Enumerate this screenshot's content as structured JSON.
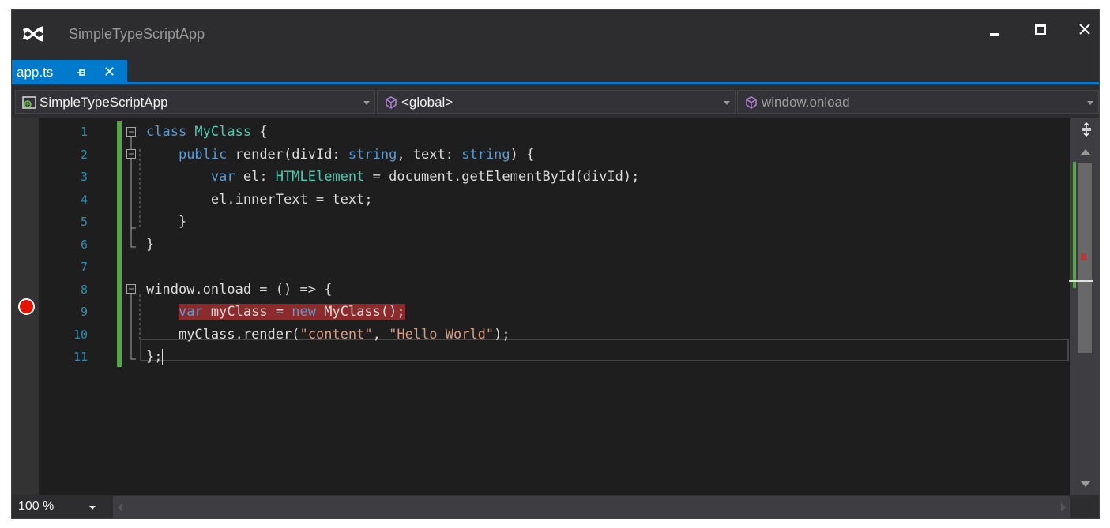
{
  "window": {
    "title": "SimpleTypeScriptApp",
    "logo_icon": "visual-studio-logo-icon",
    "controls": [
      "minimize-icon",
      "maximize-icon",
      "close-icon"
    ]
  },
  "tab": {
    "label": "app.ts",
    "pin_icon": "pin-icon",
    "close_label": "✕",
    "accent_color": "#007acc"
  },
  "navbar": {
    "project": "SimpleTypeScriptApp",
    "scope": "<global>",
    "member": "window.onload"
  },
  "editor": {
    "line_numbers": [
      "1",
      "2",
      "3",
      "4",
      "5",
      "6",
      "7",
      "8",
      "9",
      "10",
      "11"
    ],
    "lines": {
      "l1": {
        "kw": "class",
        "name": " MyClass",
        "rest": " {"
      },
      "l2": {
        "indent": "    ",
        "kw": "public",
        "a": " render(divId: ",
        "t1": "string",
        "b": ", text: ",
        "t2": "string",
        "c": ") {"
      },
      "l3": {
        "indent": "        ",
        "kw": "var",
        "a": " el: ",
        "ty": "HTMLElement",
        "b": " = document.getElementById(divId);"
      },
      "l4": {
        "text": "        el.innerText = text;"
      },
      "l5": {
        "text": "    }"
      },
      "l6": {
        "text": "}"
      },
      "l7": {
        "text": ""
      },
      "l8": {
        "text": "window.onload = () => {"
      },
      "l9": {
        "indent": "    ",
        "kw": "var",
        "a": " myClass = ",
        "kw2": "new",
        "b": " MyClass();"
      },
      "l10": {
        "indent": "    ",
        "a": "myClass.render(",
        "s1": "\"content\"",
        "b": ", ",
        "s2": "\"Hello World\"",
        "c": ");"
      },
      "l11": {
        "text": "};"
      }
    },
    "breakpoint_line": "9",
    "colors": {
      "keyword": "#569cd6",
      "type": "#4ec9b0",
      "string": "#d69d85",
      "breakpoint": "#e51400"
    }
  },
  "statusbar": {
    "zoom": "100 %"
  }
}
